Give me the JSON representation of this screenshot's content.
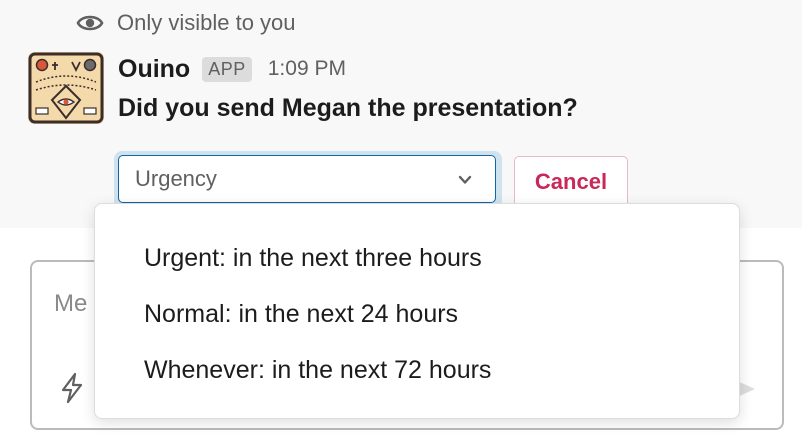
{
  "ephemeral": {
    "icon": "eye-icon",
    "text": "Only visible to you"
  },
  "message": {
    "author": "Ouino",
    "badge": "APP",
    "time": "1:09 PM",
    "text": "Did you send Megan the presentation?"
  },
  "actions": {
    "select": {
      "placeholder": "Urgency",
      "options": [
        "Urgent: in the next three hours",
        "Normal: in the next 24 hours",
        "Whenever: in the next 72 hours"
      ]
    },
    "cancel_label": "Cancel"
  },
  "composer": {
    "placeholder": "Me"
  },
  "colors": {
    "accent": "#1264a3",
    "danger": "#c8285b",
    "background": "#f8f8f8"
  }
}
